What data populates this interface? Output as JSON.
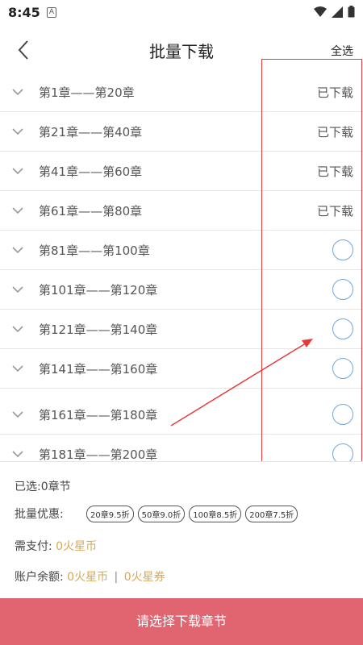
{
  "status_bar": {
    "time": "8:45",
    "notification_glyph": "A"
  },
  "header": {
    "title": "批量下载",
    "select_all": "全选"
  },
  "chapters": [
    {
      "label": "第1章——第20章",
      "state": "已下载"
    },
    {
      "label": "第21章——第40章",
      "state": "已下载"
    },
    {
      "label": "第41章——第60章",
      "state": "已下载"
    },
    {
      "label": "第61章——第80章",
      "state": "已下载"
    },
    {
      "label": "第81章——第100章",
      "state": ""
    },
    {
      "label": "第101章——第120章",
      "state": ""
    },
    {
      "label": "第121章——第140章",
      "state": ""
    },
    {
      "label": "第141章——第160章",
      "state": ""
    },
    {
      "label": "第161章——第180章",
      "state": ""
    },
    {
      "label": "第181章——第200章",
      "state": ""
    }
  ],
  "summary": {
    "selected": "已选:0章节",
    "promo_label": "批量优惠:",
    "promos": [
      "20章9.5折",
      "50章9.0折",
      "100章8.5折",
      "200章7.5折"
    ],
    "pay_label": "需支付:",
    "pay_value": "0火星币",
    "balance_label": "账户余额:",
    "balance_coins": "0火星币",
    "balance_separator": "|",
    "balance_vouchers": "0火星券"
  },
  "download_button": "请选择下载章节",
  "colors": {
    "accent_blue": "#6fa8dc",
    "gold": "#d4a85a",
    "button": "#e06570",
    "annotation_red": "#e63b3b"
  }
}
